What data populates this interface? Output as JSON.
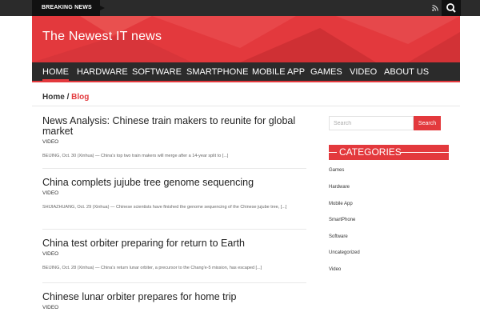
{
  "topbar": {
    "breaking_label": "BREAKING NEWS",
    "rss_icon": "rss-icon",
    "search_icon": "search-icon"
  },
  "header": {
    "site_title": "The Newest IT news"
  },
  "nav": {
    "items": [
      {
        "label": "HOME",
        "active": true
      },
      {
        "label": "HARDWARE"
      },
      {
        "label": "SOFTWARE"
      },
      {
        "label": "SMARTPHONE"
      },
      {
        "label": "MOBILE APP"
      },
      {
        "label": "GAMES"
      },
      {
        "label": "VIDEO"
      },
      {
        "label": "ABOUT US"
      }
    ]
  },
  "breadcrumb": {
    "home": "Home",
    "separator": "/",
    "current": "Blog"
  },
  "articles": [
    {
      "title": "News Analysis: Chinese train makers to reunite for global market",
      "category": "VIDEO",
      "excerpt": "BEIJING, Oct. 30 (Xinhua) — China's top two train makers will merge after a 14-year split to [...]"
    },
    {
      "title": "China complets jujube tree genome sequencing",
      "category": "VIDEO",
      "excerpt": "SHIJIAZHUANG, Oct. 29 (Xinhua) — Chinese scientists have finished the genome sequencing of the Chinese jujube tree, [...]"
    },
    {
      "title": "China test orbiter preparing for return to Earth",
      "category": "VIDEO",
      "excerpt": "BEIJING, Oct. 28 (Xinhua) — China's return lunar orbiter, a precursor to the Chang'e-5 mission, has escaped [...]"
    },
    {
      "title": "Chinese lunar orbiter prepares for home trip",
      "category": "VIDEO",
      "excerpt": ""
    }
  ],
  "sidebar": {
    "search_placeholder": "Search",
    "search_button": "Search",
    "categories_title": "CATEGORIES",
    "categories": [
      "Games",
      "Hardware",
      "Mobile App",
      "SmartPhone",
      "Software",
      "Uncategorized",
      "Video"
    ]
  },
  "colors": {
    "accent": "#e3393d",
    "dark": "#2b2b2b"
  }
}
